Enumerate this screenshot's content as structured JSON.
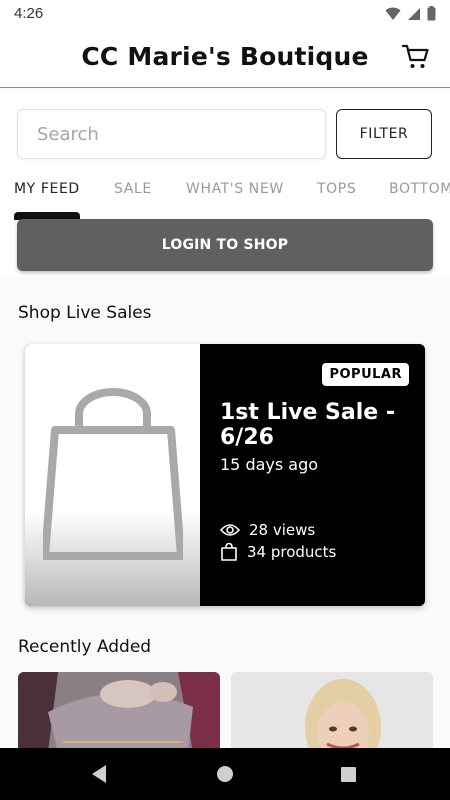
{
  "status_bar": {
    "time": "4:26"
  },
  "header": {
    "title": "CC Marie's Boutique",
    "cart_icon": "cart-icon"
  },
  "search": {
    "placeholder": "Search",
    "filter_label": "FILTER"
  },
  "tabs": [
    {
      "label": "MY FEED",
      "active": true
    },
    {
      "label": "SALE",
      "active": false
    },
    {
      "label": "WHAT'S NEW",
      "active": false
    },
    {
      "label": "TOPS",
      "active": false
    },
    {
      "label": "BOTTOMS",
      "active": false
    }
  ],
  "login_label": "LOGIN TO SHOP",
  "live_sales": {
    "section_title": "Shop Live Sales",
    "card": {
      "badge": "POPULAR",
      "title": "1st Live Sale - 6/26",
      "time": "15 days ago",
      "views": "28 views",
      "products": "34 products",
      "placeholder_icon": "shopping-bag-icon"
    }
  },
  "recently_added": {
    "section_title": "Recently Added"
  },
  "nav": {
    "back_icon": "back-icon",
    "home_icon": "home-icon",
    "recents_icon": "recents-icon"
  },
  "colors": {
    "accent": "#000000",
    "login_button": "#606060",
    "card_info_bg": "#000000"
  }
}
